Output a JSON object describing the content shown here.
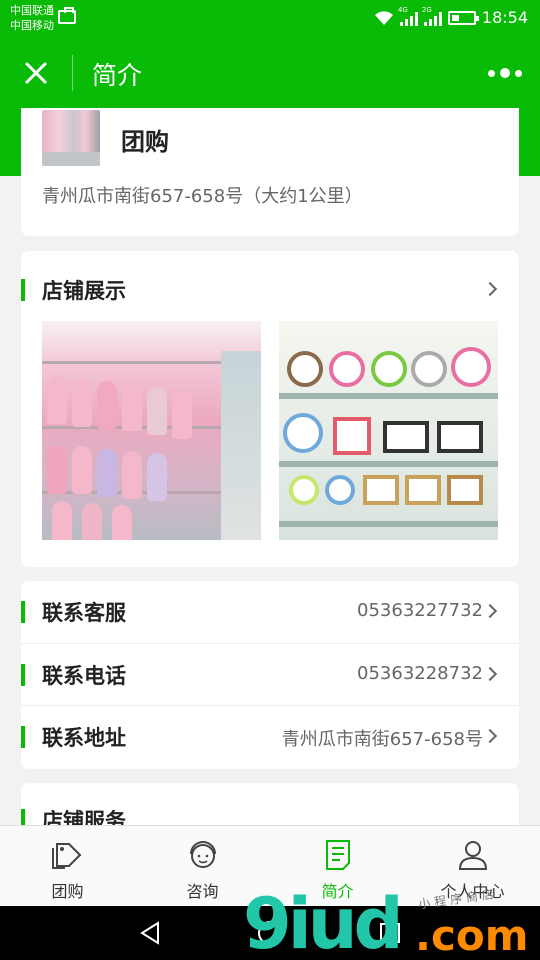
{
  "status_bar": {
    "carrier_1": "中国联通",
    "carrier_2": "中国移动",
    "network_1": "4G",
    "network_2": "2G",
    "time": "18:54"
  },
  "navbar": {
    "title": "简介",
    "close_icon": "close-icon",
    "more_icon": "more-icon"
  },
  "store": {
    "name": "团购",
    "address": "青州瓜市南街657-658号（大约1公里）"
  },
  "showcase": {
    "title": "店铺展示",
    "photos": [
      "doll-shelves-photo",
      "clock-shelves-photo"
    ]
  },
  "contact": {
    "rows": [
      {
        "label": "联系客服",
        "value": "05363227732"
      },
      {
        "label": "联系电话",
        "value": "05363228732"
      },
      {
        "label": "联系地址",
        "value": "青州瓜市南街657-658号"
      }
    ]
  },
  "service": {
    "title": "店铺服务"
  },
  "tabbar": {
    "tabs": [
      {
        "label": "团购",
        "icon": "tag-icon",
        "active": false
      },
      {
        "label": "咨询",
        "icon": "customer-service-icon",
        "active": false
      },
      {
        "label": "简介",
        "icon": "document-icon",
        "active": true
      },
      {
        "label": "个人中心",
        "icon": "user-icon",
        "active": false
      }
    ]
  },
  "watermark": {
    "brand": "9iud",
    "suffix": ".com",
    "small_text": "小程序商店"
  },
  "colors": {
    "primary_green": "#09bb07",
    "text_dark": "#222222",
    "text_gray": "#666666"
  }
}
